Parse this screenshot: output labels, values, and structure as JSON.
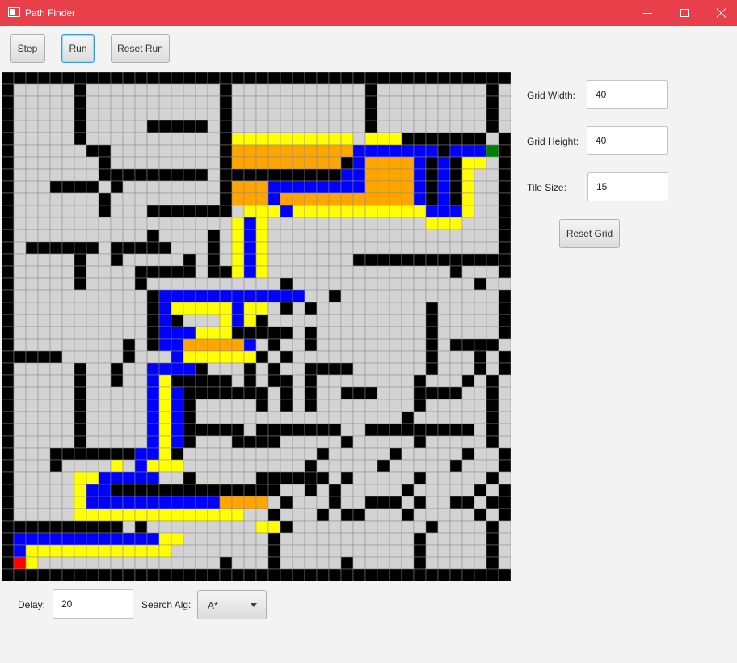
{
  "window": {
    "title": "Path Finder",
    "title_bar_color": "#e8404b"
  },
  "toolbar": {
    "step_label": "Step",
    "run_label": "Run",
    "reset_run_label": "Reset Run"
  },
  "settings": {
    "grid_width_label": "Grid Width:",
    "grid_width_value": "40",
    "grid_height_label": "Grid Height:",
    "grid_height_value": "40",
    "tile_size_label": "Tile Size:",
    "tile_size_value": "15",
    "reset_grid_label": "Reset Grid"
  },
  "bottom": {
    "delay_label": "Delay:",
    "delay_value": "20",
    "search_alg_label": "Search Alg:",
    "search_alg_value": "A*"
  },
  "grid": {
    "legend": {
      ".": "#d3d3d3",
      "#": "#000000",
      "Y": "#ffff00",
      "O": "#ffa500",
      "B": "#0000ff",
      "R": "#ff0000",
      "G": "#008000"
    },
    "line_color": "#8a8a8a",
    "rows": [
      "##########################################",
      "#.....#...........#...........#.........#",
      "#.....#...........#...........#.........#",
      "#.....#...........#...........#.........#",
      "#.....#.....#####.#...........#.........#",
      "#.....#...........#YYYYYYYYYY.YYY#######.#",
      "#......##.........#OOOOOOOOOOBBBBBBB#BBBG#",
      "#.......#.........#OOOOOOOOO#BOOOOB#B#YY.#",
      "#.......#########.##########BBOOOOB#B#Y..#",
      "#...####.#........#OOOBBBBBBBBOOOOB#B#Y..#",
      "#.......#.........#OOOBOOOOOOOOOOOB#B#Y..#",
      "#.......#...#######.YYYBYYYYYYYYYYYBBBY..#",
      "#..................YBY.............YYY...#",
      "#...........#....#.YBY...................#",
      "#.######.#####...#.YBY...................#",
      "#.....#..#.....#.#.YBY.......#############",
      "#.....#....#####.##YBY...............#...#",
      "#.....#....#...........#...............#...#",
      "#...........#BBBBBBBBBBBB..#.............#",
      "#...........#BYYYYYBYY.#.#.........#.....#",
      "#...........#B#...YBY#.............#.....#",
      "#...........#BBBYYY#####.#.........#.....#",
      "#.........#.#BBOOOOOB.#..#.........#.####",
      "#####.....#...BYYYYYY#.#...........#...#.#",
      "#.....#..#..BBBB#...#.#..####......#...#.#",
      "#.....#..#..BY#####.#.##.#........#...#.#",
      "#.....#.....BYB#######.#.#..###...####..#",
      "#.....#.....BYB#.....#.#.#........#.....#",
      "#.....#.....BYB#.................#......#",
      "#.....#.....BYB#####.#######..#########.#",
      "#.....#.....BYB#...####.....#.....#.....#",
      "#...#######BBY#...........#.....#.....#..#",
      "#...#....Y.BYYY..........#.....#.....#...#",
      "#.....YYBBBBB..#.....######.#.....#.....#",
      "#.....YBB##############..#.#.....#.....#.#",
      "#.....YBBBBBBBBBBBOOOO.#...#..###.#..##.##",
      "#.....YYYYYYYYYYYYYY..#...#.##...#.....#.#",
      "##########.#.........YY#...........#....#",
      "#BBBBBBBBBBBBYY.......#...........#.....#",
      "#BYYYYYYYYYYYY........#...........#.....#",
      "#RY...............#...#.....#.....#.....#",
      "##########################################"
    ]
  }
}
